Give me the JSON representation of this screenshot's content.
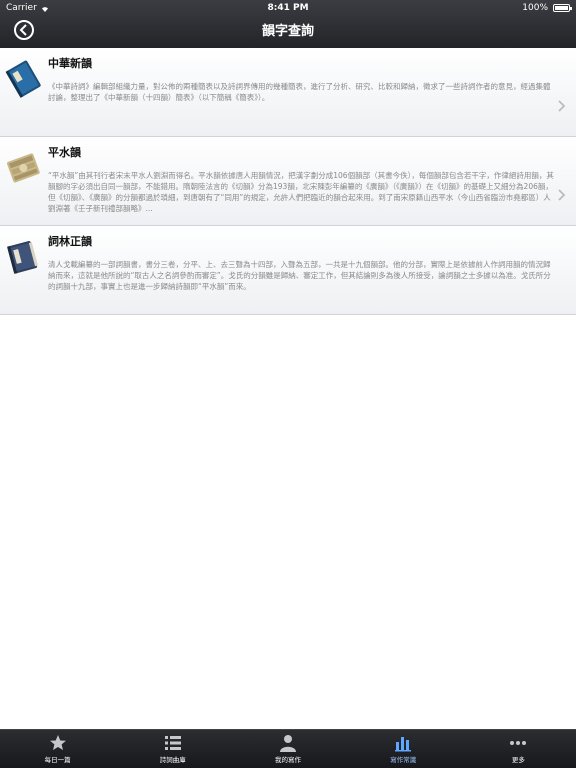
{
  "status": {
    "carrier": "Carrier",
    "time": "8:41 PM",
    "battery": "100%"
  },
  "navbar": {
    "title": "韻字查詢",
    "back_icon": "back-circle-icon"
  },
  "rows": [
    {
      "title": "中華新韻",
      "icon": "book-closed-icon",
      "desc": "《中華詩詞》編輯部組織力量，對公佈的兩種簡表以及詩詞界傳用的幾種簡表，進行了分析、研究、比較和歸納，徵求了一些詩詞作者的意見，經過集體討論，整理出了《中華新韻（十四韻）簡表》（以下簡稱《簡表》）。"
    },
    {
      "title": "平水韻",
      "icon": "scroll-stack-icon",
      "desc": "“平水韻”由其刊行者宋末平水人劉淵而得名。平水韻依據唐人用韻情況，把漢字劃分成106個韻部（其書今佚），每個韻部包含若干字，作律絕詩用韻，其韻腳的字必須出自同一韻部，不能錯用。隋朝陸法言的《切韻》分為193韻，北宋陳彭年編纂的《廣韻》（《廣韻》）在《切韻》的基礎上又細分為206韻，但《切韻》、《廣韻》的分韻都過於瑣細，到唐朝有了“同用”的規定，允許人們把臨近的韻合起來用。到了南宋原籍山西平水（今山西省臨汾市堯都區）人劉淵著《壬子新刊禮部韻略》..."
    },
    {
      "title": "詞林正韻",
      "icon": "book-open-icon",
      "desc": "清人戈載編纂的一部詞韻書，書分三卷，分平、上、去三聲為十四部，入聲為五部，一共是十九個韻部。他的分部，實際上是依據前人作詞用韻的情況歸納而來，這就是他所說的“取古人之名詞參酌而審定”。戈氏的分韻雖是歸納、審定工作，但其結論則多為後人所接受，論詞韻之士多據以為准。戈氏所分的詞韻十九部，事實上也是進一步歸納詩韻即“平水韻”而來。"
    }
  ],
  "tabs": [
    {
      "label": "每日一篇",
      "icon": "star-icon"
    },
    {
      "label": "詩詞曲庫",
      "icon": "list-icon"
    },
    {
      "label": "我的寫作",
      "icon": "person-icon"
    },
    {
      "label": "寫作常識",
      "icon": "bar-chart-icon",
      "active": true
    },
    {
      "label": "更多",
      "icon": "more-dots-icon"
    }
  ],
  "colors": {
    "navbar": "#2e3034",
    "tabbar": "#1f2023",
    "active_tab": "#9fc8ff"
  }
}
